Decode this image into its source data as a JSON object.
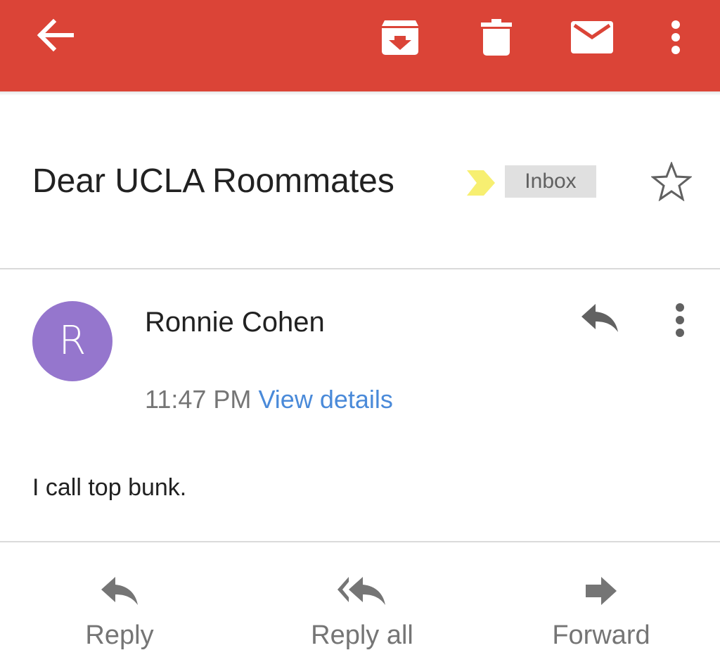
{
  "colors": {
    "appbar": "#db4437",
    "avatar": "#9576cd",
    "link": "#4a8ad9",
    "importance_marker": "#f7ef71",
    "label_chip_bg": "#e0e0e0"
  },
  "toolbar": {
    "back_icon": "arrow-back-icon",
    "archive_icon": "archive-icon",
    "delete_icon": "trash-icon",
    "mark_unread_icon": "mail-icon",
    "more_icon": "more-vert-icon"
  },
  "thread": {
    "subject": "Dear UCLA Roommates",
    "label": "Inbox"
  },
  "message": {
    "avatar_letter": "R",
    "sender": "Ronnie Cohen",
    "time": "11:47 PM",
    "details_link": "View details",
    "body": "I call top bunk."
  },
  "actions": {
    "reply": "Reply",
    "reply_all": "Reply all",
    "forward": "Forward"
  }
}
